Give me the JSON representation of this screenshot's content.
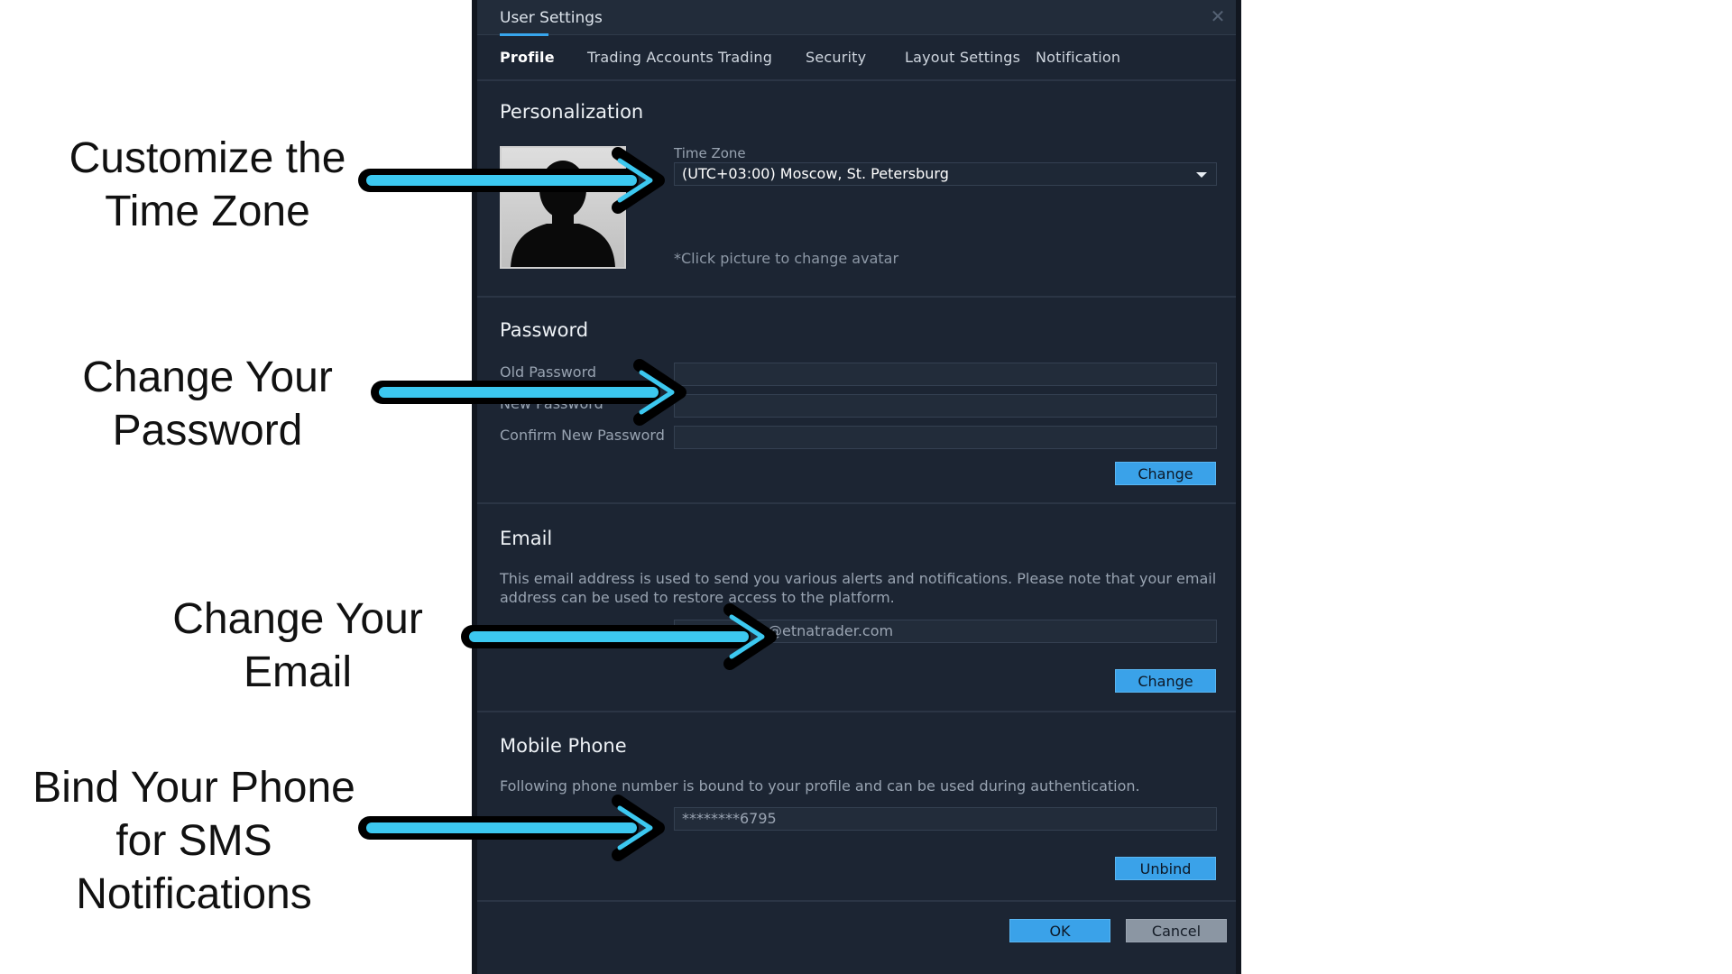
{
  "annotations": [
    {
      "text": "Customize the\nTime Zone"
    },
    {
      "text": "Change Your\nPassword"
    },
    {
      "text": "Change Your\nEmail"
    },
    {
      "text": "Bind Your Phone\nfor SMS\nNotifications"
    }
  ],
  "arrow_colors": {
    "fill": "#3cc8f0",
    "outline": "#000000"
  },
  "dialog": {
    "title": "User Settings",
    "close_icon": "close-icon",
    "tabs": [
      {
        "label": "Profile",
        "active": true
      },
      {
        "label": "Trading Accounts"
      },
      {
        "label": "Trading"
      },
      {
        "label": "Security"
      },
      {
        "label": "Layout Settings"
      },
      {
        "label": "Notification"
      }
    ],
    "personalization": {
      "title": "Personalization",
      "time_zone_label": "Time Zone",
      "time_zone_value": "(UTC+03:00) Moscow, St. Petersburg",
      "avatar_hint": "*Click picture to change avatar"
    },
    "password": {
      "title": "Password",
      "old_label": "Old Password",
      "new_label": "New Password",
      "confirm_label": "Confirm New Password",
      "change_button": "Change"
    },
    "email": {
      "title": "Email",
      "description": "This email address is used to send you various alerts and notifications. Please note that your email address can be used to restore access to the platform.",
      "value": "@etnatrader.com",
      "change_button": "Change"
    },
    "mobile": {
      "title": "Mobile Phone",
      "description": "Following phone number is bound to your profile and can be used during authentication.",
      "value": "********6795",
      "unbind_button": "Unbind"
    },
    "footer": {
      "ok": "OK",
      "cancel": "Cancel"
    },
    "accent_color": "#37a6ee"
  }
}
